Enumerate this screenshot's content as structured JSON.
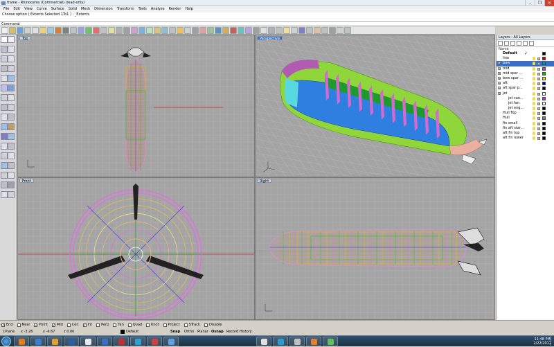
{
  "window": {
    "title": "frame - Rhinoceros (Commercial) (read-only)",
    "controls": [
      "–",
      "❐",
      "✕"
    ]
  },
  "menu": [
    "File",
    "Edit",
    "View",
    "Curve",
    "Surface",
    "Solid",
    "Mesh",
    "Dimension",
    "Transform",
    "Tools",
    "Analyze",
    "Render",
    "Help"
  ],
  "command_history": [
    "Choose option ( Extents  Selected  1To1 ) : _Extents"
  ],
  "command_prompt": "Command:",
  "viewports": {
    "top": "Top",
    "perspective": "Perspective",
    "front": "Front",
    "right": "Right"
  },
  "layers": {
    "title": "Layers - All Layers",
    "column_name": "Name",
    "rows": [
      {
        "name": "Default",
        "indent": 0,
        "bold": true,
        "check": "✓",
        "color": "#000000",
        "expand": false
      },
      {
        "name": "line",
        "indent": 0,
        "color": "#c00000",
        "expand": false
      },
      {
        "name": "bow",
        "indent": 0,
        "selected": true,
        "color": "#00a0a0",
        "expand": true
      },
      {
        "name": "mid",
        "indent": 0,
        "color": "#c040c0",
        "expand": true
      },
      {
        "name": "mid spar ...",
        "indent": 0,
        "color": "#00c000",
        "expand": true
      },
      {
        "name": "bow spar ...",
        "indent": 0,
        "color": "#e0e000",
        "expand": true
      },
      {
        "name": "aft",
        "indent": 0,
        "color": "#0000c0",
        "expand": true
      },
      {
        "name": "aft spar p...",
        "indent": 0,
        "color": "#000000",
        "expand": true
      },
      {
        "name": "jet",
        "indent": 0,
        "color": "#ffffff",
        "expand": true
      },
      {
        "name": "jet can...",
        "indent": 2,
        "color": "#a040c0"
      },
      {
        "name": "jet fan",
        "indent": 2,
        "color": "#ffffff"
      },
      {
        "name": "jet eng...",
        "indent": 2,
        "color": "#000000"
      },
      {
        "name": "Hull Top",
        "indent": 0,
        "color": "#000000"
      },
      {
        "name": "Hull",
        "indent": 0,
        "color": "#808080"
      },
      {
        "name": "fin small",
        "indent": 0,
        "color": "#000000"
      },
      {
        "name": "fin aft star...",
        "indent": 0,
        "color": "#000000"
      },
      {
        "name": "aft fin top",
        "indent": 0,
        "color": "#000000"
      },
      {
        "name": "aft fin lower",
        "indent": 0,
        "color": "#000000"
      }
    ]
  },
  "osnap": [
    {
      "label": "End",
      "checked": true
    },
    {
      "label": "Near",
      "checked": false
    },
    {
      "label": "Point",
      "checked": true
    },
    {
      "label": "Mid",
      "checked": true
    },
    {
      "label": "Cen",
      "checked": false
    },
    {
      "label": "Int",
      "checked": true
    },
    {
      "label": "Perp",
      "checked": false
    },
    {
      "label": "Tan",
      "checked": false
    },
    {
      "label": "Quad",
      "checked": false
    },
    {
      "label": "Knot",
      "checked": false
    },
    {
      "label": "Project",
      "checked": false
    },
    {
      "label": "STrack",
      "checked": false
    },
    {
      "label": "Disable",
      "checked": false
    }
  ],
  "status": {
    "cplane": "CPlane",
    "x": "x -3.26",
    "y": "y -6.67",
    "z": "z 0.00",
    "layer": "Default",
    "toggles": [
      "Snap",
      "Ortho",
      "Planar",
      "Osnap",
      "Record History"
    ]
  },
  "taskbar": {
    "time": "11:48 PM",
    "date": "2/22/2012"
  }
}
